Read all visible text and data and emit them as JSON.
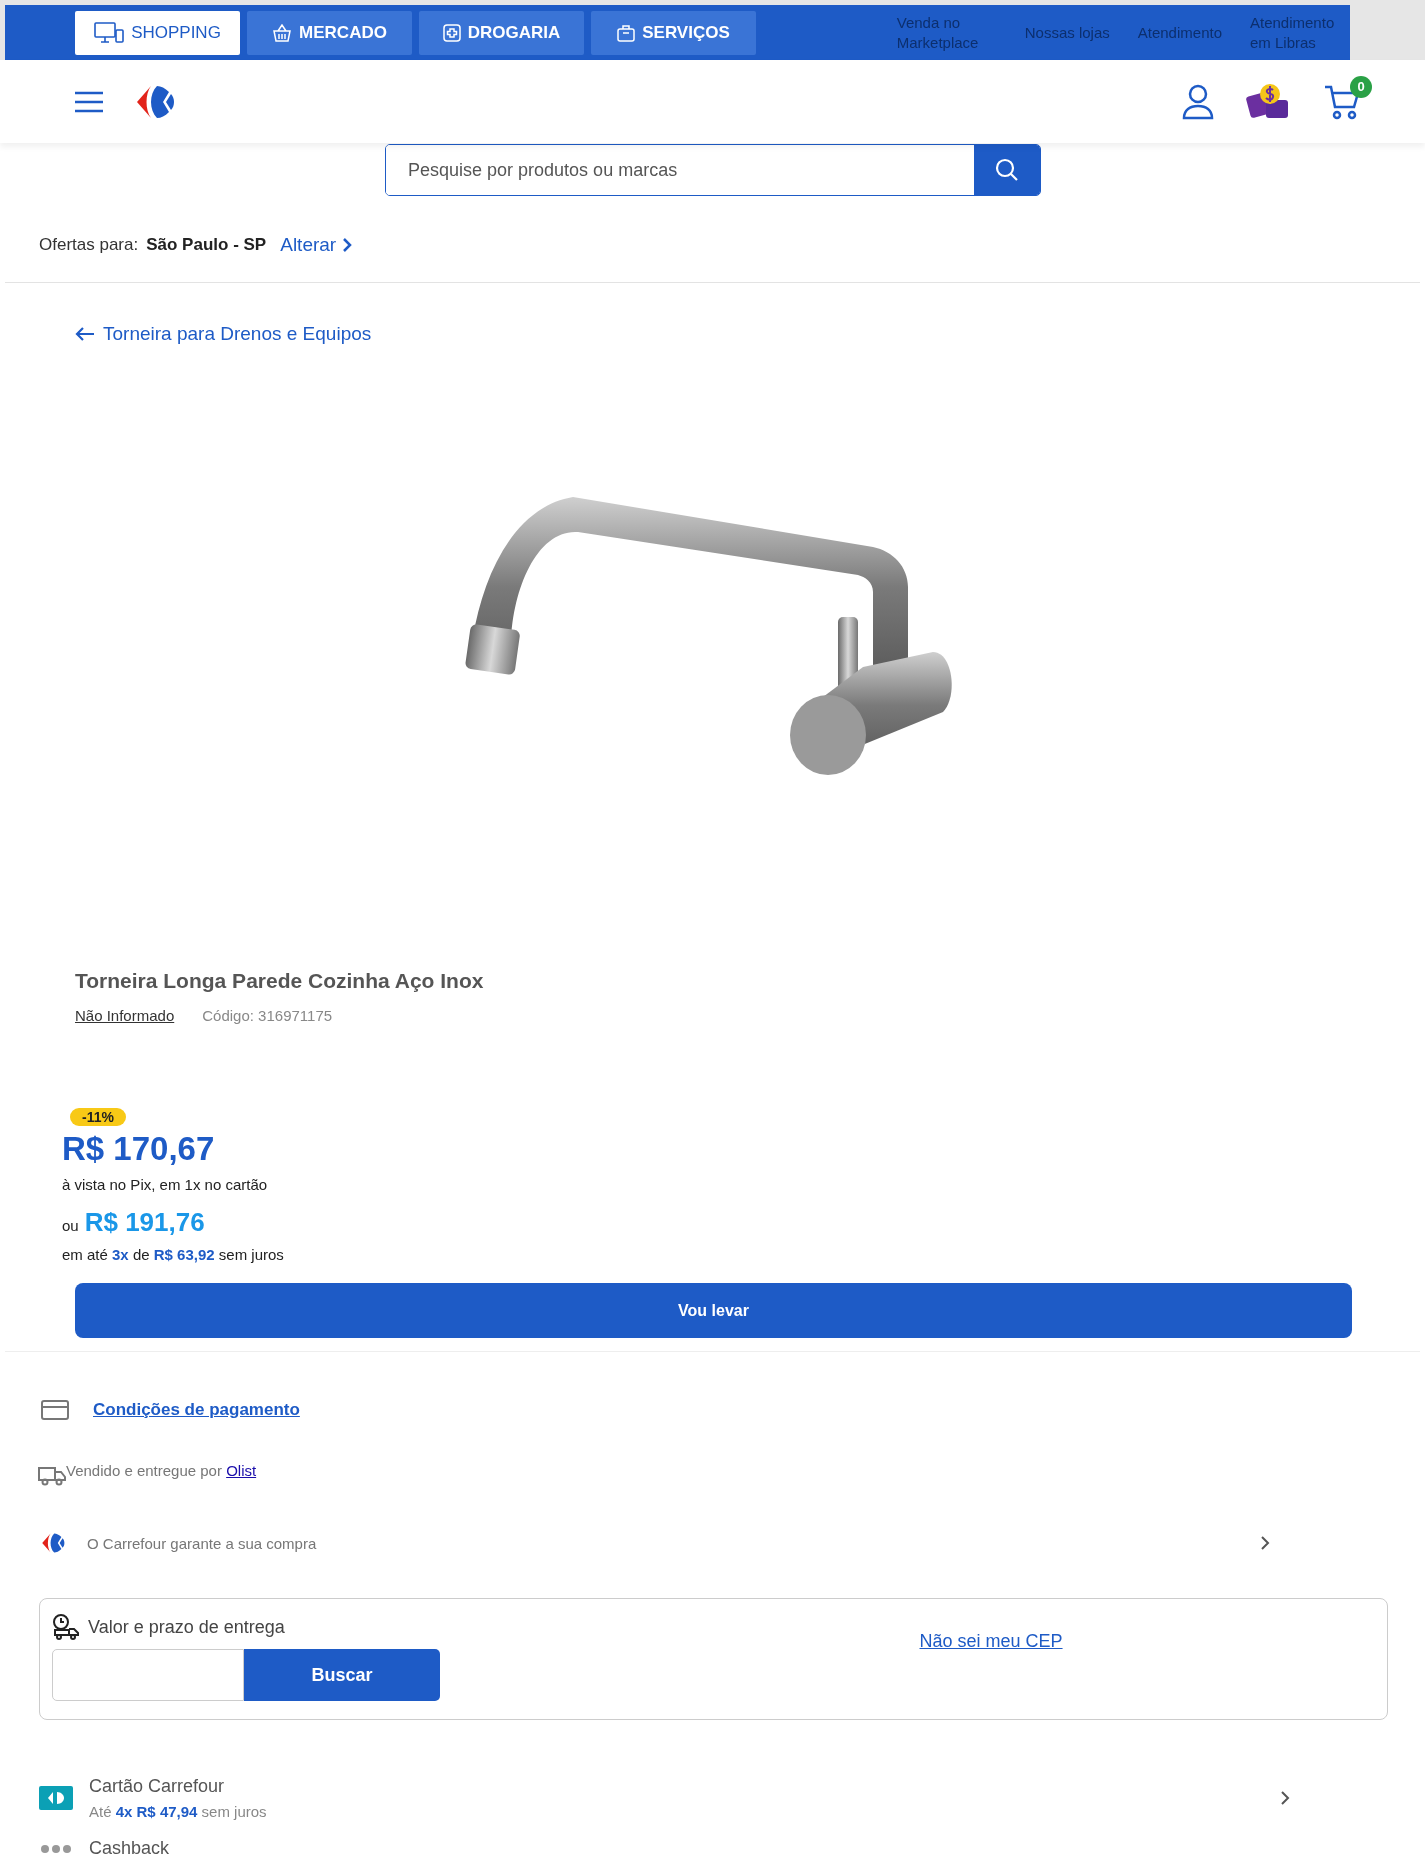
{
  "top_tabs": [
    {
      "label": "SHOPPING",
      "kind": "monitor",
      "selected": true
    },
    {
      "label": "MERCADO",
      "kind": "basket",
      "selected": false
    },
    {
      "label": "DROGARIA",
      "kind": "pharmacy",
      "selected": false
    },
    {
      "label": "SERVIÇOS",
      "kind": "bag",
      "selected": false
    }
  ],
  "top_links": [
    "Venda no Marketplace",
    "Nossas lojas",
    "Atendimento",
    "Atendimento em Libras"
  ],
  "header": {
    "cart_count": "0"
  },
  "search": {
    "placeholder": "Pesquise por produtos ou marcas"
  },
  "location": {
    "label": "Ofertas para:",
    "city": "São Paulo - SP",
    "change_link": "Alterar"
  },
  "breadcrumb": "Torneira para Drenos e Equipos",
  "product": {
    "title": "Torneira Longa Parede Cozinha Aço Inox",
    "brand": "Não Informado",
    "code": "Código: 316971175"
  },
  "price": {
    "discount": "-11%",
    "pix_price": "R$ 170,67",
    "pix_note": "à vista no Pix, em 1x no cartão",
    "or": "ou",
    "card_price": "R$ 191,76",
    "installments": "em até **3x** de **R$ 63,92** sem juros"
  },
  "buy_button": "Vou levar",
  "payment_link": "Condições de pagamento",
  "seller": {
    "text": "Vendido e entregue por",
    "link": "Olist"
  },
  "guarantee": "O Carrefour garante a sua compra",
  "delivery": {
    "title": "Valor e prazo de entrega",
    "button": "Buscar",
    "help_link": "Não sei meu CEP"
  },
  "card_offer": {
    "title": "Cartão Carrefour",
    "detail": "Até **4x R$ 47,94** sem juros"
  },
  "cashback": {
    "title": "Cashback"
  }
}
